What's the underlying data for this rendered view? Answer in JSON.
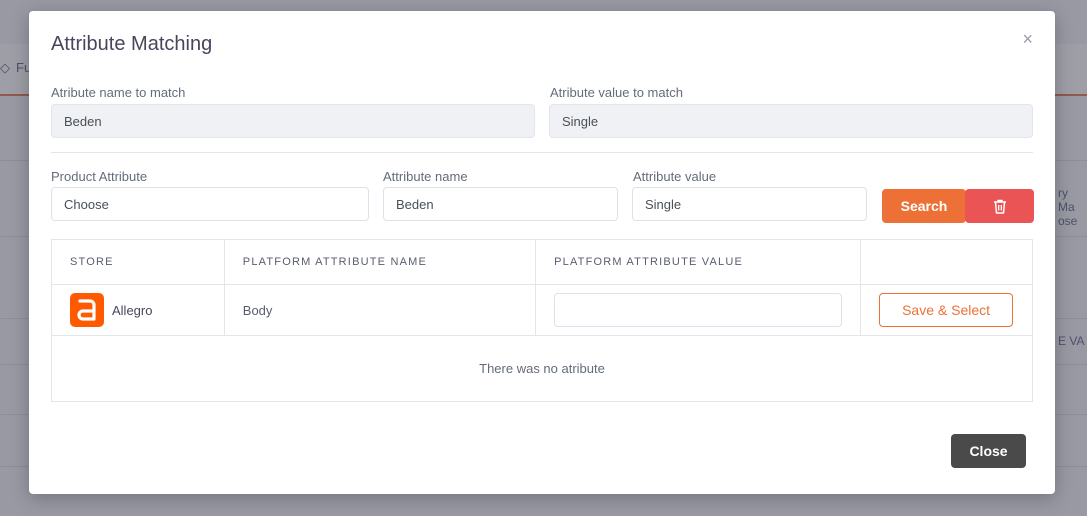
{
  "background": {
    "breadcrumb_fragment": "Fu",
    "right_fragment_1": "ry Ma",
    "right_fragment_2": "ose",
    "right_fragment_3": "E VA"
  },
  "modal": {
    "title": "Attribute Matching",
    "close_symbol": "×"
  },
  "match": {
    "name_label": "Atribute name to match",
    "name_value": "Beden",
    "value_label": "Atribute value to match",
    "value_value": "Single"
  },
  "filters": {
    "product_attribute_label": "Product Attribute",
    "product_attribute_value": "Choose",
    "attribute_name_label": "Attribute name",
    "attribute_name_value": "Beden",
    "attribute_value_label": "Attribute value",
    "attribute_value_value": "Single",
    "search_label": "Search",
    "delete_icon": "trash-icon"
  },
  "table": {
    "headers": [
      "STORE",
      "PLATFORM ATTRIBUTE NAME",
      "PLATFORM ATTRIBUTE VALUE",
      ""
    ],
    "rows": [
      {
        "store_logo_icon": "allegro-logo",
        "store_name": "Allegro",
        "platform_attribute_name": "Body",
        "platform_attribute_value": "",
        "action_label": "Save & Select"
      }
    ],
    "empty_message": "There was no atribute"
  },
  "footer": {
    "close_label": "Close"
  },
  "colors": {
    "accent": "#ed7136",
    "danger": "#ea5455",
    "close_button": "#4a4a4a",
    "allegro": "#ff5a00"
  }
}
